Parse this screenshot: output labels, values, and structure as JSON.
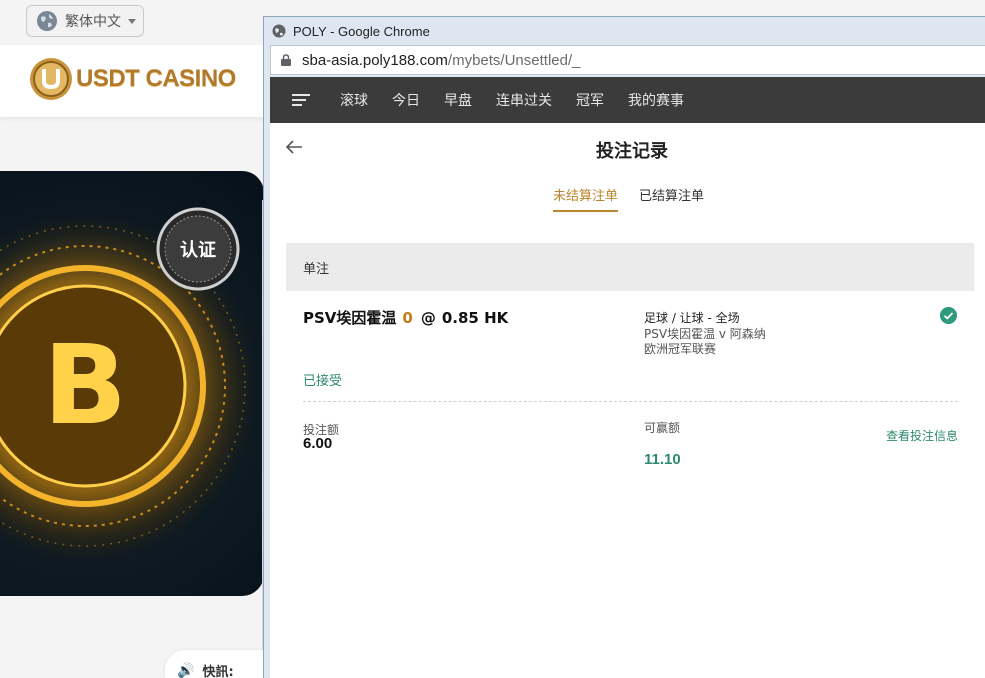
{
  "background": {
    "language_label": "繁体中文",
    "logo_text": "USDT CASINO",
    "banner_badge": "认证",
    "notice_label": "快訊:"
  },
  "window": {
    "title": "POLY - Google Chrome",
    "url_host": "sba-asia.poly188.com",
    "url_path": "/mybets/Unsettled/_"
  },
  "nav": {
    "items": [
      "滚球",
      "今日",
      "早盘",
      "连串过关",
      "冠军",
      "我的赛事"
    ]
  },
  "page": {
    "title": "投注记录",
    "tabs": {
      "unsettled": "未结算注单",
      "settled": "已结算注单"
    },
    "section_label": "单注"
  },
  "bet": {
    "selection": "PSV埃因霍温",
    "handicap": "0",
    "at": "@",
    "odds": "0.85 HK",
    "market": "足球 / 让球 - 全场",
    "match": "PSV埃因霍温 v 阿森纳",
    "league": "欧洲冠军联赛",
    "status": "已接受",
    "stake_label": "投注额",
    "stake_value": "6.00",
    "win_label": "可赢额",
    "win_value": "11.10",
    "view_link": "查看投注信息"
  },
  "colors": {
    "accent_gold": "#b8862a",
    "accent_green": "#2e8a70",
    "nav_bg": "#3b3b3b"
  }
}
